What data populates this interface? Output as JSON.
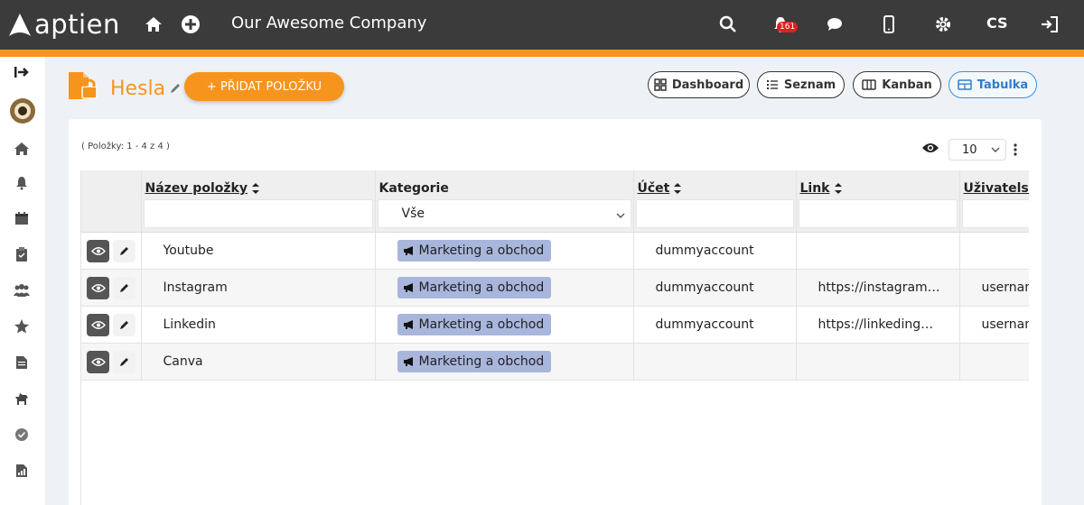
{
  "topbar": {
    "logo_text": "aptien",
    "company": "Our Awesome Company",
    "notifications_count": "161",
    "language": "CS",
    "colors": {
      "bar": "#3b3b3b",
      "accent": "#f7941d"
    }
  },
  "page": {
    "title": "Hesla",
    "add_button": "+ PŘIDAT POLOŽKU",
    "views": [
      {
        "label": "Dashboard",
        "icon": "dashboard-icon"
      },
      {
        "label": "Seznam",
        "icon": "list-icon"
      },
      {
        "label": "Kanban",
        "icon": "kanban-icon"
      },
      {
        "label": "Tabulka",
        "icon": "table-icon",
        "active": true
      }
    ]
  },
  "table": {
    "items_count": "( Položky: 1 - 4 z 4 )",
    "per_page": "10",
    "columns": [
      "Název položky",
      "Kategorie",
      "Účet",
      "Link",
      "Uživatelske"
    ],
    "category_filter": "Vše",
    "rows": [
      {
        "name": "Youtube",
        "category": "Marketing a obchod",
        "account": "dummyaccount",
        "link": "",
        "user": ""
      },
      {
        "name": "Instagram",
        "category": "Marketing a obchod",
        "account": "dummyaccount",
        "link": "https://instagram…",
        "user": "usernam"
      },
      {
        "name": "Linkedin",
        "category": "Marketing a obchod",
        "account": "dummyaccount",
        "link": "https://linkeding…",
        "user": "usernam"
      },
      {
        "name": "Canva",
        "category": "Marketing a obchod",
        "account": "",
        "link": "",
        "user": ""
      }
    ]
  }
}
